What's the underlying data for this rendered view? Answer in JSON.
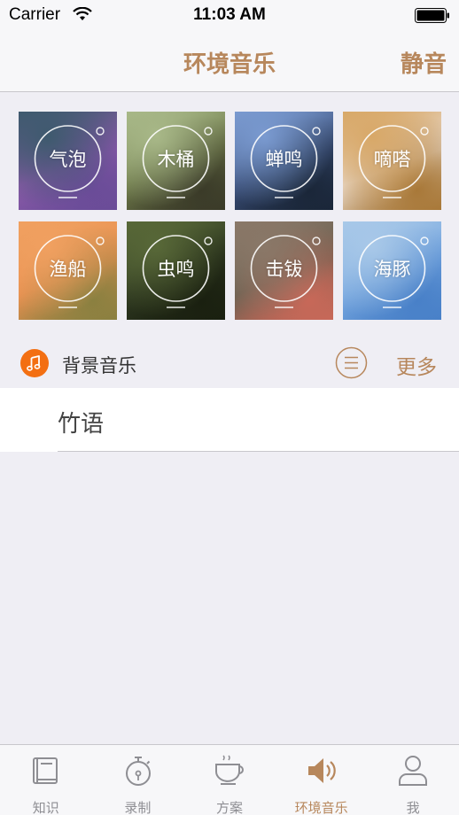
{
  "status_bar": {
    "carrier": "Carrier",
    "time": "11:03 AM"
  },
  "nav": {
    "title": "环境音乐",
    "right_action": "静音"
  },
  "sounds": [
    {
      "label": "气泡",
      "colors": [
        "#3e5a6e",
        "#8a5aa8",
        "#6a4c98"
      ]
    },
    {
      "label": "木桶",
      "colors": [
        "#a8b888",
        "#6e7a4a",
        "#3a3a28"
      ]
    },
    {
      "label": "蝉鸣",
      "colors": [
        "#7a9ad0",
        "#3a4e78",
        "#1a2638"
      ]
    },
    {
      "label": "嘀嗒",
      "colors": [
        "#d8a868",
        "#e8d8c8",
        "#a87838"
      ]
    },
    {
      "label": "渔船",
      "colors": [
        "#f0a060",
        "#e89050",
        "#8a8040"
      ]
    },
    {
      "label": "虫鸣",
      "colors": [
        "#586838",
        "#2e3820",
        "#1a2010"
      ]
    },
    {
      "label": "击钹",
      "colors": [
        "#8a7868",
        "#6a6050",
        "#c86858"
      ]
    },
    {
      "label": "海豚",
      "colors": [
        "#a8c8e8",
        "#78a8e0",
        "#4880c8"
      ]
    }
  ],
  "background_music": {
    "title": "背景音乐",
    "more_label": "更多",
    "accent": "#f36f12"
  },
  "tracks": [
    {
      "label": "竹语"
    }
  ],
  "tabs": [
    {
      "label": "知识",
      "icon": "book-icon"
    },
    {
      "label": "录制",
      "icon": "stopwatch-icon"
    },
    {
      "label": "方案",
      "icon": "cup-icon"
    },
    {
      "label": "环境音乐",
      "icon": "speaker-icon",
      "active": true
    },
    {
      "label": "我",
      "icon": "person-icon"
    }
  ],
  "colors": {
    "brand": "#b7875c",
    "inactive": "#8e8e93",
    "background": "#efeef4"
  }
}
